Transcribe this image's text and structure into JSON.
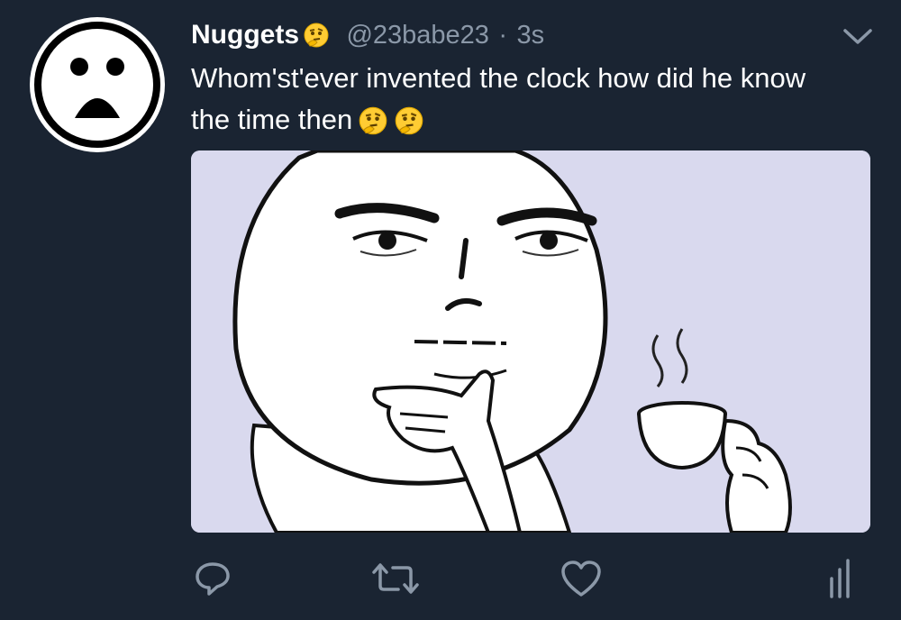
{
  "tweet": {
    "display_name": "Nuggets",
    "handle": "@23babe23",
    "separator": "·",
    "time": "3s",
    "text_line_1": "Whom'st'ever invented the clock how did he know",
    "text_line_2": "the time then",
    "name_emoji": "thinking-face",
    "text_emojis": [
      "thinking-face",
      "thinking-face"
    ]
  },
  "colors": {
    "background": "#1a2432",
    "secondary_text": "#8b98a8",
    "icon": "#8b98a8"
  },
  "icons": {
    "caret": "chevron-down-icon",
    "reply": "reply-icon",
    "retweet": "retweet-icon",
    "like": "heart-icon",
    "analytics": "analytics-icon"
  }
}
